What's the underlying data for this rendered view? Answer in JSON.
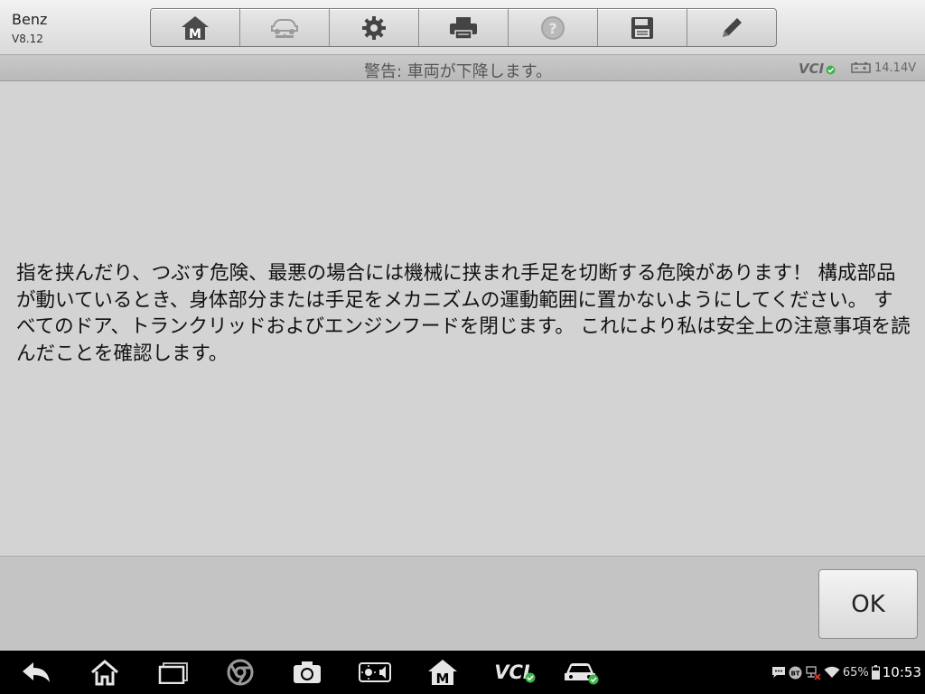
{
  "app": {
    "name": "Benz",
    "version": "V8.12"
  },
  "toolbar": {
    "buttons": [
      {
        "icon": "home-m-icon"
      },
      {
        "icon": "vehicle-lift-icon"
      },
      {
        "icon": "gear-icon"
      },
      {
        "icon": "printer-icon"
      },
      {
        "icon": "help-icon"
      },
      {
        "icon": "save-icon"
      },
      {
        "icon": "pencil-icon"
      }
    ]
  },
  "status": {
    "message": "警告: 車両が下降します。",
    "vci": "VCI",
    "voltage": "14.14V"
  },
  "main": {
    "warning_text": "指を挟んだり、つぶす危険、最悪の場合には機械に挟まれ手足を切断する危険があります！ 構成部品が動いているとき、身体部分または手足をメカニズムの運動範囲に置かないようにしてください。 すべてのドア、トランクリッドおよびエンジンフードを閉じます。 これにより私は安全上の注意事項を読んだことを確認します。"
  },
  "footer": {
    "ok_label": "OK"
  },
  "system_bar": {
    "items": [
      "back-icon",
      "home-icon",
      "recents-icon",
      "chrome-icon",
      "camera-icon",
      "brightness-icon",
      "home-m-icon",
      "vci-icon",
      "car-icon"
    ],
    "vci_label": "VCI",
    "battery": "65%",
    "time": "10:53"
  },
  "colors": {
    "accent_green": "#3bb54a",
    "background": "#d3d3d3"
  }
}
